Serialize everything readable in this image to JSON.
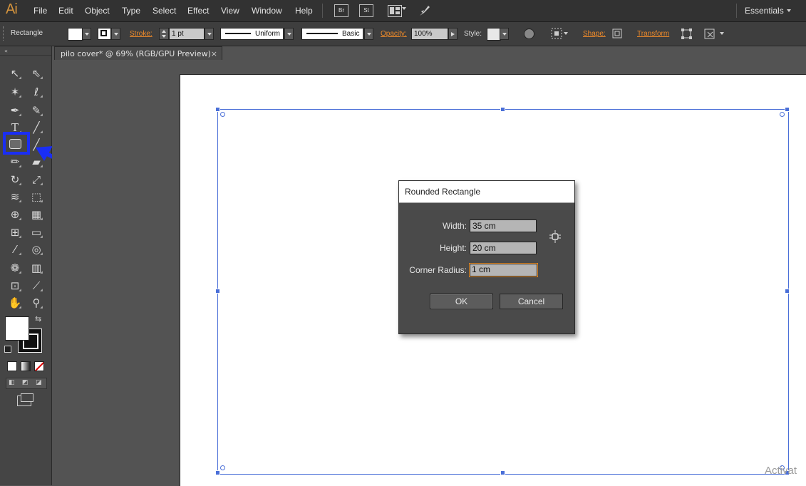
{
  "app": {
    "logo": "Ai"
  },
  "menubar": {
    "items": [
      "File",
      "Edit",
      "Object",
      "Type",
      "Select",
      "Effect",
      "View",
      "Window",
      "Help"
    ],
    "bridge_label": "Br",
    "stock_label": "St",
    "workspace": "Essentials"
  },
  "control_bar": {
    "selection_type": "Rectangle",
    "stroke_label": "Stroke:",
    "stroke_weight": "1 pt",
    "profile_label": "Uniform",
    "brush_label": "Basic",
    "opacity_label": "Opacity:",
    "opacity_value": "100%",
    "style_label": "Style:",
    "shape_label": "Shape:",
    "transform_label": "Transform"
  },
  "document_tab": {
    "title": "pilo cover* @ 69% (RGB/GPU Preview)",
    "close_glyph": "×"
  },
  "dialog": {
    "title": "Rounded Rectangle",
    "width_label": "Width:",
    "width_value": "35 cm",
    "height_label": "Height:",
    "height_value": "20 cm",
    "corner_label": "Corner Radius:",
    "corner_value": "1 cm",
    "ok_label": "OK",
    "cancel_label": "Cancel"
  },
  "watermark": "Activat",
  "colors": {
    "accent_orange": "#ee8a2a",
    "highlight_blue": "#1a2ef5",
    "selection_blue": "#4a6fd8"
  }
}
